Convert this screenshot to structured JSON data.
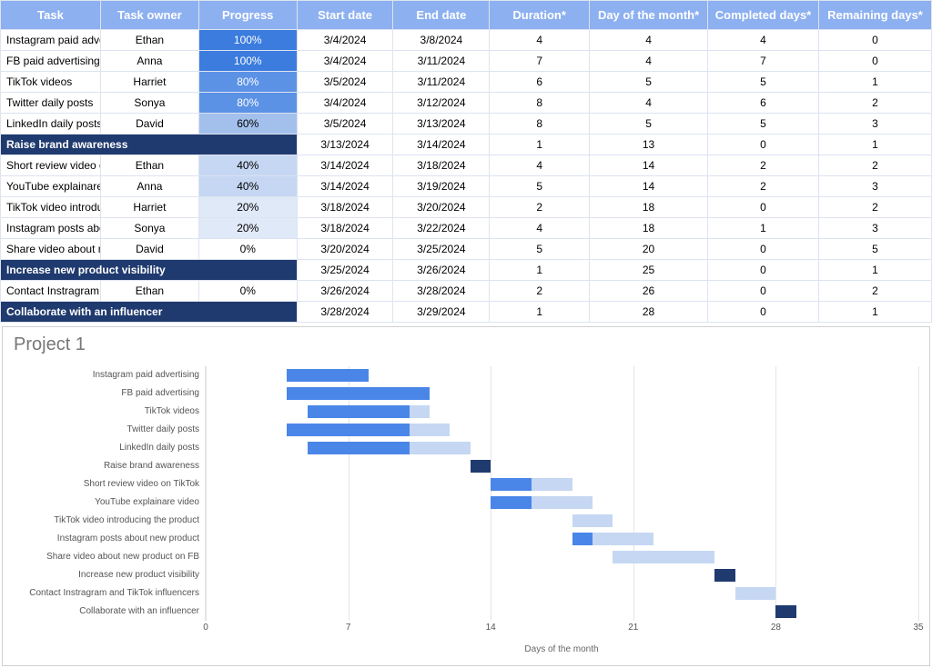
{
  "table": {
    "headers": [
      "Task",
      "Task owner",
      "Progress",
      "Start date",
      "End date",
      "Duration*",
      "Day of the month*",
      "Completed days*",
      "Remaining days*"
    ],
    "rows": [
      {
        "type": "task",
        "task": "Instagram paid advertising",
        "owner": "Ethan",
        "progress": "100%",
        "pclass": "progress-100",
        "start": "3/4/2024",
        "end": "3/8/2024",
        "duration": "4",
        "dom": "4",
        "comp": "4",
        "rem": "0"
      },
      {
        "type": "task",
        "task": "FB paid advertising",
        "owner": "Anna",
        "progress": "100%",
        "pclass": "progress-100",
        "start": "3/4/2024",
        "end": "3/11/2024",
        "duration": "7",
        "dom": "4",
        "comp": "7",
        "rem": "0"
      },
      {
        "type": "task",
        "task": "TikTok videos",
        "owner": "Harriet",
        "progress": "80%",
        "pclass": "progress-80",
        "start": "3/5/2024",
        "end": "3/11/2024",
        "duration": "6",
        "dom": "5",
        "comp": "5",
        "rem": "1"
      },
      {
        "type": "task",
        "task": "Twitter daily posts",
        "owner": "Sonya",
        "progress": "80%",
        "pclass": "progress-80",
        "start": "3/4/2024",
        "end": "3/12/2024",
        "duration": "8",
        "dom": "4",
        "comp": "6",
        "rem": "2"
      },
      {
        "type": "task",
        "task": "LinkedIn daily posts",
        "owner": "David",
        "progress": "60%",
        "pclass": "progress-60",
        "start": "3/5/2024",
        "end": "3/13/2024",
        "duration": "8",
        "dom": "5",
        "comp": "5",
        "rem": "3"
      },
      {
        "type": "milestone",
        "task": "Raise brand awareness",
        "start": "3/13/2024",
        "end": "3/14/2024",
        "duration": "1",
        "dom": "13",
        "comp": "0",
        "rem": "1"
      },
      {
        "type": "task",
        "task": "Short review video on TikTok",
        "owner": "Ethan",
        "progress": "40%",
        "pclass": "progress-40",
        "start": "3/14/2024",
        "end": "3/18/2024",
        "duration": "4",
        "dom": "14",
        "comp": "2",
        "rem": "2"
      },
      {
        "type": "task",
        "task": "YouTube explainare video",
        "owner": "Anna",
        "progress": "40%",
        "pclass": "progress-40",
        "start": "3/14/2024",
        "end": "3/19/2024",
        "duration": "5",
        "dom": "14",
        "comp": "2",
        "rem": "3"
      },
      {
        "type": "task",
        "task": "TikTok video introducing the product",
        "owner": "Harriet",
        "progress": "20%",
        "pclass": "progress-20",
        "start": "3/18/2024",
        "end": "3/20/2024",
        "duration": "2",
        "dom": "18",
        "comp": "0",
        "rem": "2"
      },
      {
        "type": "task",
        "task": "Instagram posts about new product",
        "owner": "Sonya",
        "progress": "20%",
        "pclass": "progress-20",
        "start": "3/18/2024",
        "end": "3/22/2024",
        "duration": "4",
        "dom": "18",
        "comp": "1",
        "rem": "3"
      },
      {
        "type": "task",
        "task": "Share video about new product on FB",
        "owner": "David",
        "progress": "0%",
        "pclass": "progress-0",
        "start": "3/20/2024",
        "end": "3/25/2024",
        "duration": "5",
        "dom": "20",
        "comp": "0",
        "rem": "5"
      },
      {
        "type": "milestone",
        "task": "Increase new product visibility",
        "start": "3/25/2024",
        "end": "3/26/2024",
        "duration": "1",
        "dom": "25",
        "comp": "0",
        "rem": "1"
      },
      {
        "type": "task",
        "task": "Contact Instragram and TikTok influencers",
        "owner": "Ethan",
        "progress": "0%",
        "pclass": "progress-0",
        "start": "3/26/2024",
        "end": "3/28/2024",
        "duration": "2",
        "dom": "26",
        "comp": "0",
        "rem": "2"
      },
      {
        "type": "milestone",
        "task": "Collaborate with an influencer",
        "start": "3/28/2024",
        "end": "3/29/2024",
        "duration": "1",
        "dom": "28",
        "comp": "0",
        "rem": "1"
      }
    ]
  },
  "chart_data": {
    "type": "bar",
    "title": "Project 1",
    "xlabel": "Days of the month",
    "xlim": [
      0,
      35
    ],
    "xticks": [
      0,
      7,
      14,
      21,
      28,
      35
    ],
    "tasks": [
      {
        "name": "Instagram paid advertising",
        "start": 4,
        "duration": 4,
        "completed": 4,
        "milestone": false
      },
      {
        "name": "FB paid advertising",
        "start": 4,
        "duration": 7,
        "completed": 7,
        "milestone": false
      },
      {
        "name": "TikTok videos",
        "start": 5,
        "duration": 6,
        "completed": 5,
        "milestone": false
      },
      {
        "name": "Twitter daily posts",
        "start": 4,
        "duration": 8,
        "completed": 6,
        "milestone": false
      },
      {
        "name": "LinkedIn daily posts",
        "start": 5,
        "duration": 8,
        "completed": 5,
        "milestone": false
      },
      {
        "name": "Raise brand awareness",
        "start": 13,
        "duration": 1,
        "completed": 0,
        "milestone": true
      },
      {
        "name": "Short review video on TikTok",
        "start": 14,
        "duration": 4,
        "completed": 2,
        "milestone": false
      },
      {
        "name": "YouTube explainare video",
        "start": 14,
        "duration": 5,
        "completed": 2,
        "milestone": false
      },
      {
        "name": "TikTok video introducing the product",
        "start": 18,
        "duration": 2,
        "completed": 0,
        "milestone": false
      },
      {
        "name": "Instagram posts about new product",
        "start": 18,
        "duration": 4,
        "completed": 1,
        "milestone": false
      },
      {
        "name": "Share video about new product on FB",
        "start": 20,
        "duration": 5,
        "completed": 0,
        "milestone": false
      },
      {
        "name": "Increase new product visibility",
        "start": 25,
        "duration": 1,
        "completed": 0,
        "milestone": true
      },
      {
        "name": "Contact Instragram and TikTok influencers",
        "start": 26,
        "duration": 2,
        "completed": 0,
        "milestone": false
      },
      {
        "name": "Collaborate with an influencer",
        "start": 28,
        "duration": 1,
        "completed": 0,
        "milestone": true
      }
    ]
  }
}
